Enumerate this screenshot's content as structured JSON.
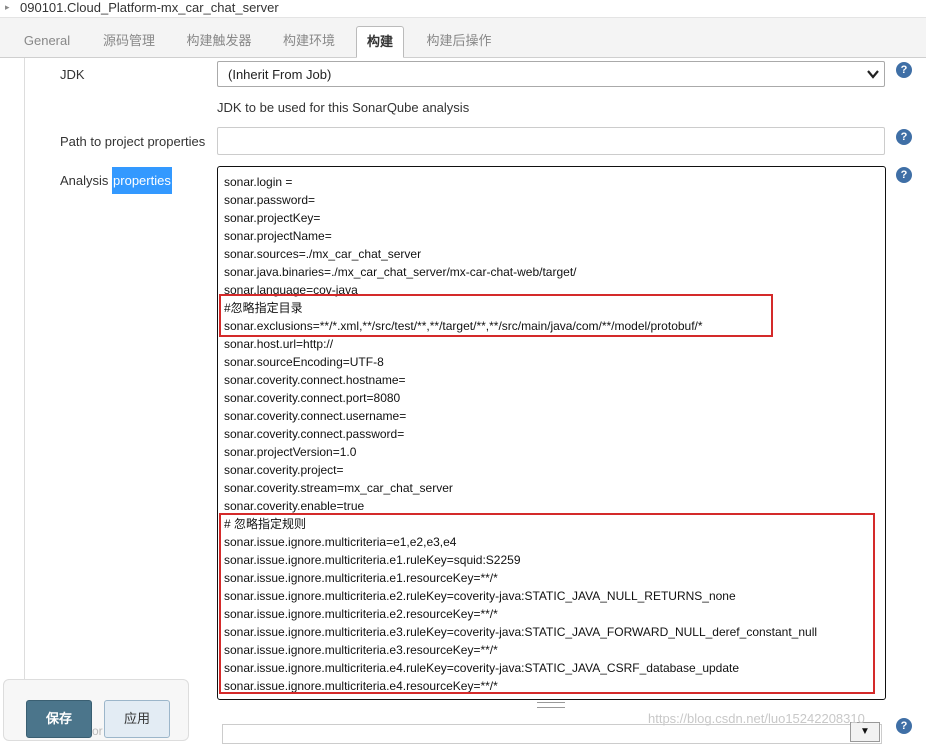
{
  "breadcrumb": {
    "project": "090101.Cloud_Platform-mx_car_chat_server"
  },
  "tabs": [
    {
      "label": "General"
    },
    {
      "label": "源码管理"
    },
    {
      "label": "构建触发器"
    },
    {
      "label": "构建环境"
    },
    {
      "label": "构建",
      "active": true
    },
    {
      "label": "构建后操作"
    }
  ],
  "form": {
    "jdk_label": "JDK",
    "jdk_value": "(Inherit From Job)",
    "jdk_desc": "JDK to be used for this SonarQube analysis",
    "path_label": "Path to project properties",
    "path_value": "",
    "analysis_label_a": "Analysis ",
    "analysis_label_b": "properties",
    "properties_lines": [
      "sonar.login =",
      "sonar.password=",
      "sonar.projectKey=",
      "sonar.projectName=",
      "sonar.sources=./mx_car_chat_server",
      "sonar.java.binaries=./mx_car_chat_server/mx-car-chat-web/target/",
      "sonar.language=cov-java",
      "#忽略指定目录",
      "sonar.exclusions=**/*.xml,**/src/test/**,**/target/**,**/src/main/java/com/**/model/protobuf/*",
      "sonar.host.url=http://",
      "sonar.sourceEncoding=UTF-8",
      "sonar.coverity.connect.hostname=",
      "sonar.coverity.connect.port=8080",
      "sonar.coverity.connect.username=",
      "sonar.coverity.connect.password=",
      "sonar.projectVersion=1.0",
      "sonar.coverity.project=",
      "sonar.coverity.stream=mx_car_chat_server",
      "sonar.coverity.enable=true",
      "# 忽略指定规则",
      "sonar.issue.ignore.multicriteria=e1,e2,e3,e4",
      "sonar.issue.ignore.multicriteria.e1.ruleKey=squid:S2259",
      "sonar.issue.ignore.multicriteria.e1.resourceKey=**/*",
      "sonar.issue.ignore.multicriteria.e2.ruleKey=coverity-java:STATIC_JAVA_NULL_RETURNS_none",
      "sonar.issue.ignore.multicriteria.e2.resourceKey=**/*",
      "sonar.issue.ignore.multicriteria.e3.ruleKey=coverity-java:STATIC_JAVA_FORWARD_NULL_deref_constant_null",
      "sonar.issue.ignore.multicriteria.e3.resourceKey=**/*",
      "sonar.issue.ignore.multicriteria.e4.ruleKey=coverity-java:STATIC_JAVA_CSRF_database_update",
      "sonar.issue.ignore.multicriteria.e4.resourceKey=**/*"
    ]
  },
  "help_glyph": "?",
  "buttons": {
    "save": "保存",
    "apply": "应用"
  },
  "bottom": {
    "dropdown_glyph": "▼"
  },
  "watermark": "https://blog.csdn.net/luo15242208310",
  "colors": {
    "highlight_box": "#d42a2a",
    "save_button": "#4b758b",
    "help_icon": "#3f6fa6",
    "selection": "#3399ff"
  }
}
